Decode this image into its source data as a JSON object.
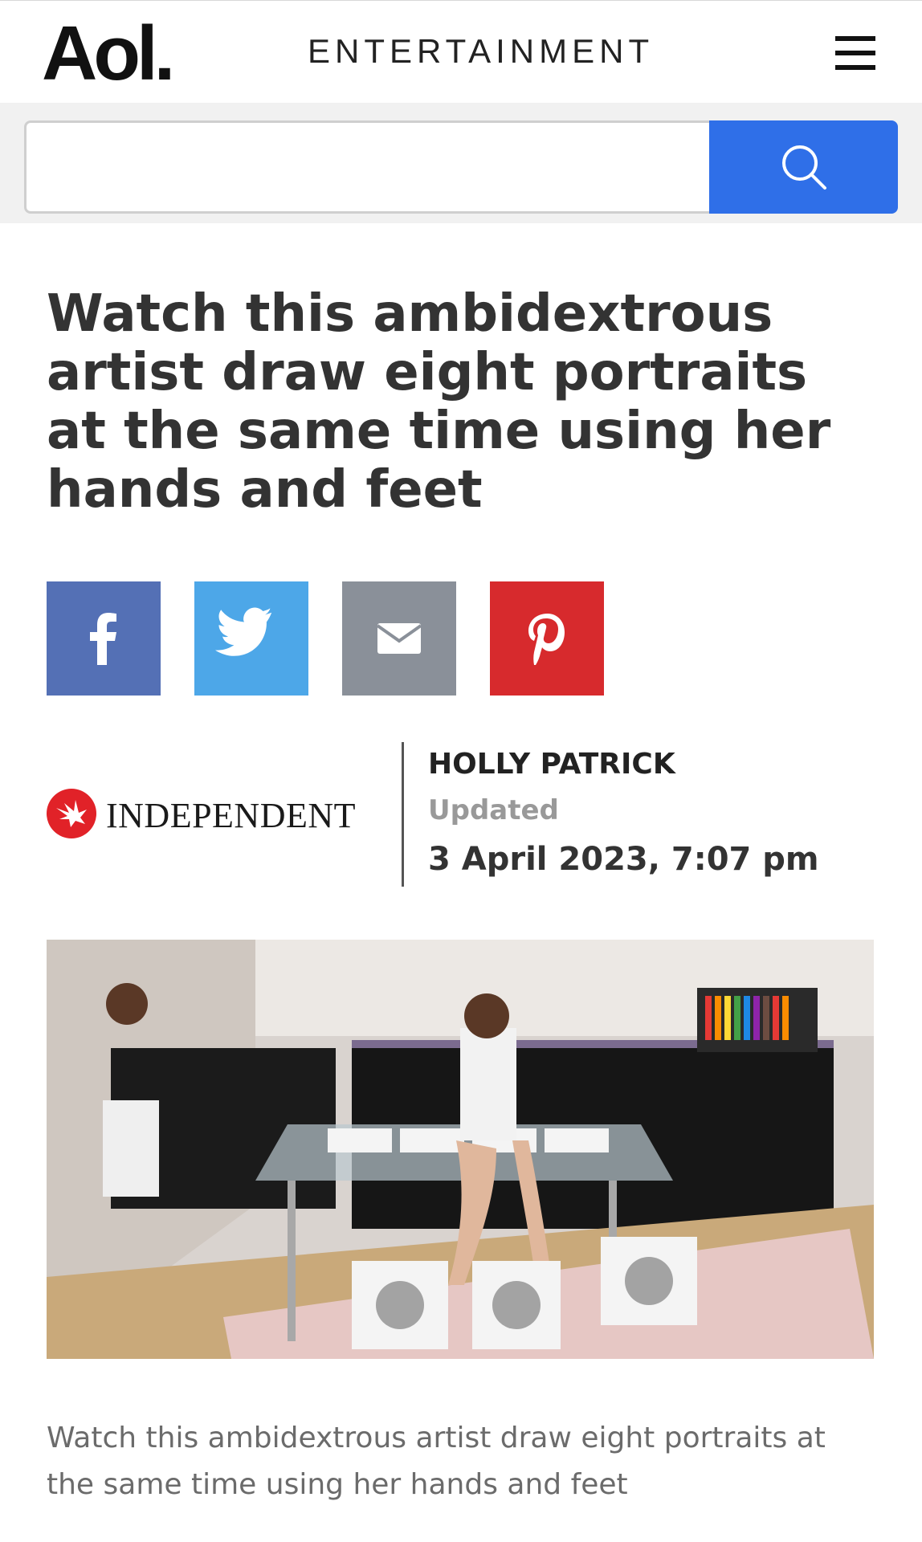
{
  "header": {
    "logo_text": "Aol.",
    "section": "ENTERTAINMENT",
    "menu_icon": "hamburger-menu-icon"
  },
  "search": {
    "placeholder": "",
    "button_icon": "search-icon",
    "button_color": "#2f6fe8"
  },
  "article": {
    "headline": "Watch this ambidextrous artist draw eight portraits at the same time using her hands and feet",
    "share_buttons": [
      {
        "network": "facebook",
        "icon": "facebook-icon",
        "color": "#5470b5"
      },
      {
        "network": "twitter",
        "icon": "twitter-icon",
        "color": "#4da7e8"
      },
      {
        "network": "email",
        "icon": "email-icon",
        "color": "#8a9099"
      },
      {
        "network": "pinterest",
        "icon": "pinterest-icon",
        "color": "#d72a2d"
      }
    ],
    "source": {
      "name": "INDEPENDENT",
      "logo_icon": "eagle-logo-icon",
      "logo_color": "#e12228"
    },
    "author": "HOLLY PATRICK",
    "updated_label": "Updated",
    "updated_date": "3 April 2023, 7:07 pm",
    "image": {
      "description_icon": "article-photo"
    },
    "caption": "Watch this ambidextrous artist draw eight portraits at the same time using her hands and feet"
  }
}
